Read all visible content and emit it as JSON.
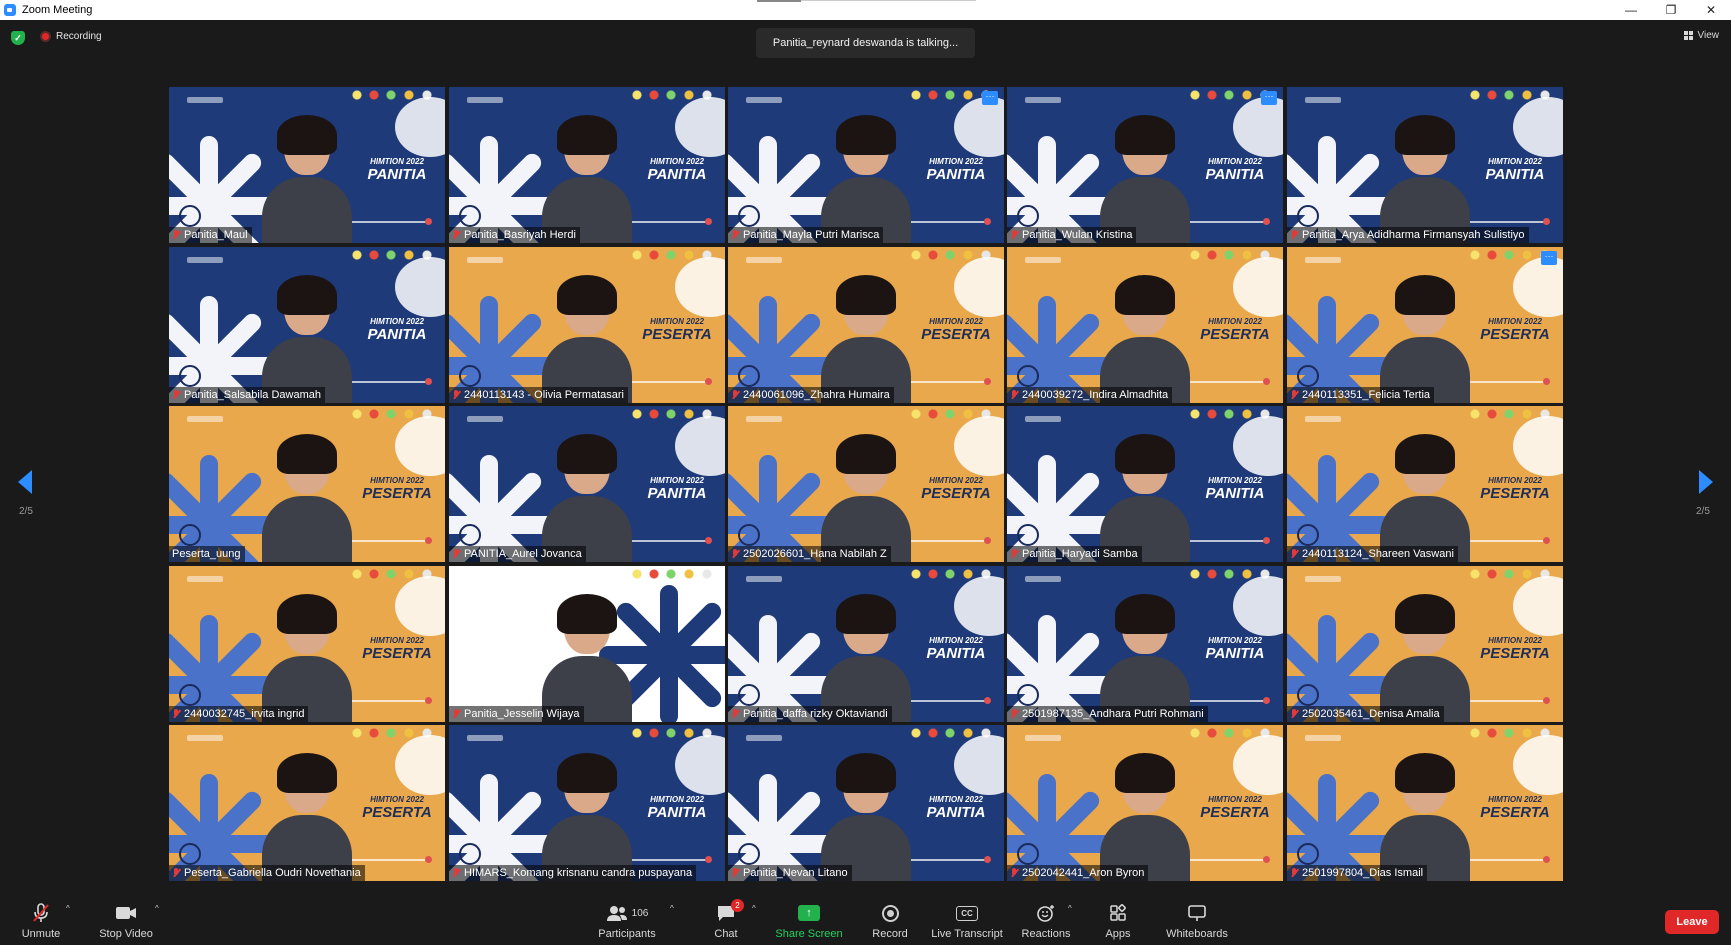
{
  "window": {
    "title": "Zoom Meeting",
    "controls": [
      "minimize",
      "restore",
      "close"
    ]
  },
  "meeting": {
    "recording_label": "Recording",
    "talking_text": "Panitia_reynard deswanda is talking...",
    "view_label": "View",
    "page_indicator": "2/5",
    "colors": {
      "accent": "#2d8cff",
      "recording": "#e02828",
      "share": "#23b14d",
      "panitia_bg": "#1f3a78",
      "peserta_bg": "#e9a84c"
    }
  },
  "participants": [
    {
      "name": "Panitia_Maul",
      "bg": "blue",
      "role": "PANITIA",
      "year": "HIMTION 2022",
      "muted": true,
      "more": false
    },
    {
      "name": "Panitia_Basriyah Herdi",
      "bg": "blue",
      "role": "PANITIA",
      "year": "HIMTION 2022",
      "muted": true,
      "more": false
    },
    {
      "name": "Panitia_Mayla Putri Marisca",
      "bg": "blue",
      "role": "PANITIA",
      "year": "HIMTION 2022",
      "muted": true,
      "more": true
    },
    {
      "name": "Panitia_Wulan Kristina",
      "bg": "blue",
      "role": "PANITIA",
      "year": "HIMTION 2022",
      "muted": true,
      "more": true
    },
    {
      "name": "Panitia_Arya Adidharma Firmansyah Sulistiyo",
      "bg": "blue",
      "role": "PANITIA",
      "year": "HIMTION 2022",
      "muted": true,
      "more": false
    },
    {
      "name": "Panitia_Salsabila Dawamah",
      "bg": "blue",
      "role": "PANITIA",
      "year": "HIMTION 2022",
      "muted": true,
      "more": false
    },
    {
      "name": "2440113143 - Olivia Permatasari",
      "bg": "orange",
      "role": "PESERTA",
      "year": "HIMTION 2022",
      "muted": true,
      "more": false
    },
    {
      "name": "2440061096_Zhahra Humaira",
      "bg": "orange",
      "role": "PESERTA",
      "year": "HIMTION 2022",
      "muted": true,
      "more": false
    },
    {
      "name": "2440039272_Indira Almadhita",
      "bg": "orange",
      "role": "PESERTA",
      "year": "HIMTION 2022",
      "muted": true,
      "more": false
    },
    {
      "name": "2440113351_Felicia Tertia",
      "bg": "orange",
      "role": "PESERTA",
      "year": "HIMTION 2022",
      "muted": true,
      "more": true
    },
    {
      "name": "Peserta_uung",
      "bg": "orange",
      "role": "PESERTA",
      "year": "HIMTION 2022",
      "muted": false,
      "more": false
    },
    {
      "name": "PANITIA_Aurel Jovanca",
      "bg": "blue",
      "role": "PANITIA",
      "year": "HIMTION 2022",
      "muted": true,
      "more": false
    },
    {
      "name": "2502026601_Hana Nabilah Z",
      "bg": "orange",
      "role": "PESERTA",
      "year": "HIMTION 2022",
      "muted": true,
      "more": false
    },
    {
      "name": "Panitia_Haryadi Samba",
      "bg": "blue",
      "role": "PANITIA",
      "year": "HIMTION 2022",
      "muted": true,
      "more": false
    },
    {
      "name": "2440113124_Shareen Vaswani",
      "bg": "orange",
      "role": "PESERTA",
      "year": "HIMTION 2022",
      "muted": true,
      "more": false
    },
    {
      "name": "2440032745_irvita ingrid",
      "bg": "orange",
      "role": "PESERTA",
      "year": "HIMTION 2022",
      "muted": true,
      "more": false
    },
    {
      "name": "Panitia_Jesselin Wijaya",
      "bg": "inverse",
      "role": "",
      "year": "",
      "muted": true,
      "more": false
    },
    {
      "name": "Panitia_daffa rizky Oktaviandi",
      "bg": "blue",
      "role": "PANITIA",
      "year": "HIMTION 2022",
      "muted": true,
      "more": false
    },
    {
      "name": "2501987135_Andhara Putri Rohmani",
      "bg": "blue",
      "role": "PANITIA",
      "year": "HIMTION 2022",
      "muted": true,
      "more": false
    },
    {
      "name": "2502035461_Denisa Amalia",
      "bg": "orange",
      "role": "PESERTA",
      "year": "HIMTION 2022",
      "muted": true,
      "more": false
    },
    {
      "name": "Peserta_Gabriella Oudri Novethania",
      "bg": "orange",
      "role": "PESERTA",
      "year": "HIMTION 2022",
      "muted": true,
      "more": false
    },
    {
      "name": "HIMARS_Komang krisnanu candra puspayana",
      "bg": "blue",
      "role": "PANITIA",
      "year": "HIMTION 2022",
      "muted": true,
      "more": false
    },
    {
      "name": "Panitia_Nevan Litano",
      "bg": "blue",
      "role": "PANITIA",
      "year": "HIMTION 2022",
      "muted": true,
      "more": false
    },
    {
      "name": "2502042441_Aron Byron",
      "bg": "orange",
      "role": "PESERTA",
      "year": "HIMTION 2022",
      "muted": true,
      "more": false
    },
    {
      "name": "2501997804_Dias Ismail",
      "bg": "orange",
      "role": "PESERTA",
      "year": "HIMTION 2022",
      "muted": true,
      "more": false
    }
  ],
  "tile_overlay": {
    "more_label": "···"
  },
  "toolbar": {
    "unmute": "Unmute",
    "stop_video": "Stop Video",
    "participants": "Participants",
    "participants_count": "106",
    "chat": "Chat",
    "chat_badge": "2",
    "share_screen": "Share Screen",
    "record": "Record",
    "live_transcript": "Live Transcript",
    "cc_icon": "CC",
    "reactions": "Reactions",
    "apps": "Apps",
    "whiteboards": "Whiteboards",
    "leave": "Leave"
  }
}
